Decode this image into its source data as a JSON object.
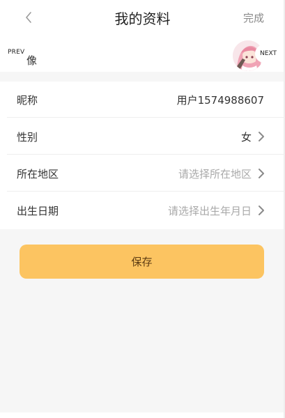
{
  "header": {
    "title": "我的资料",
    "done_label": "完成"
  },
  "avatar_row": {
    "label": "像",
    "prev_label": "PREV",
    "next_label": "NEXT"
  },
  "fields": {
    "nickname": {
      "label": "昵称",
      "value": "用户1574988607"
    },
    "gender": {
      "label": "性别",
      "value": "女"
    },
    "region": {
      "label": "所在地区",
      "placeholder": "请选择所在地区"
    },
    "birthday": {
      "label": "出生日期",
      "placeholder": "请选择出生年月日"
    }
  },
  "save_label": "保存",
  "colors": {
    "accent": "#fcc461",
    "placeholder": "#a9a9a9",
    "background": "#f6f6f6"
  },
  "icons": {
    "back": "chevron-left-icon",
    "row_arrow": "chevron-right-icon",
    "avatar": "anime-avatar-image"
  }
}
